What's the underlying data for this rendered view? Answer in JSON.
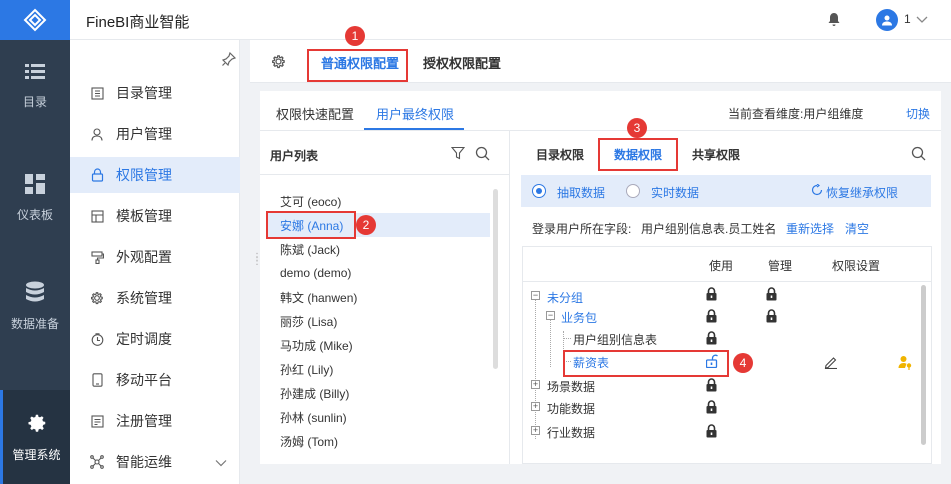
{
  "app": {
    "title": "FineBI商业智能"
  },
  "user": {
    "name": "1"
  },
  "rail": {
    "items": [
      {
        "label": "目录",
        "icon": "list-icon"
      },
      {
        "label": "仪表板",
        "icon": "dashboard-icon"
      },
      {
        "label": "数据准备",
        "icon": "database-icon"
      },
      {
        "label": "管理系统",
        "icon": "gear-icon"
      }
    ]
  },
  "subnav": {
    "items": [
      {
        "label": "目录管理"
      },
      {
        "label": "用户管理"
      },
      {
        "label": "权限管理"
      },
      {
        "label": "模板管理"
      },
      {
        "label": "外观配置"
      },
      {
        "label": "系统管理"
      },
      {
        "label": "定时调度"
      },
      {
        "label": "移动平台"
      },
      {
        "label": "注册管理"
      },
      {
        "label": "智能运维"
      }
    ]
  },
  "header_tabs": [
    {
      "label": "普通权限配置"
    },
    {
      "label": "授权权限配置"
    }
  ],
  "sub_tabs": [
    {
      "label": "权限快速配置"
    },
    {
      "label": "用户最终权限"
    }
  ],
  "dimension": {
    "text": "当前查看维度:用户组维度",
    "switch_label": "切换"
  },
  "user_list": {
    "title": "用户列表",
    "users": [
      "艾可 (eoco)",
      "安娜 (Anna)",
      "陈斌 (Jack)",
      "demo (demo)",
      "韩文 (hanwen)",
      "丽莎 (Lisa)",
      "马功成 (Mike)",
      "孙红 (Lily)",
      "孙建成 (Billy)",
      "孙林 (sunlin)",
      "汤姆 (Tom)"
    ]
  },
  "perm_tabs": [
    {
      "label": "目录权限"
    },
    {
      "label": "数据权限"
    },
    {
      "label": "共享权限"
    }
  ],
  "extract": {
    "option1": "抽取数据",
    "option2": "实时数据",
    "restore": "恢复继承权限"
  },
  "field": {
    "label": "登录用户所在字段:",
    "value": "用户组别信息表.员工姓名",
    "reselect": "重新选择",
    "clear": "清空"
  },
  "table": {
    "headers": {
      "use": "使用",
      "manage": "管理",
      "setting": "权限设置"
    },
    "rows": [
      {
        "label": "未分组"
      },
      {
        "label": "业务包"
      },
      {
        "label": "用户组别信息表"
      },
      {
        "label": "薪资表"
      },
      {
        "label": "场景数据"
      },
      {
        "label": "功能数据"
      },
      {
        "label": "行业数据"
      }
    ]
  },
  "badges": [
    "1",
    "2",
    "3",
    "4"
  ],
  "colors": {
    "accent": "#2c78e4",
    "rail": "#2f3e50",
    "highlight": "#e53935"
  }
}
